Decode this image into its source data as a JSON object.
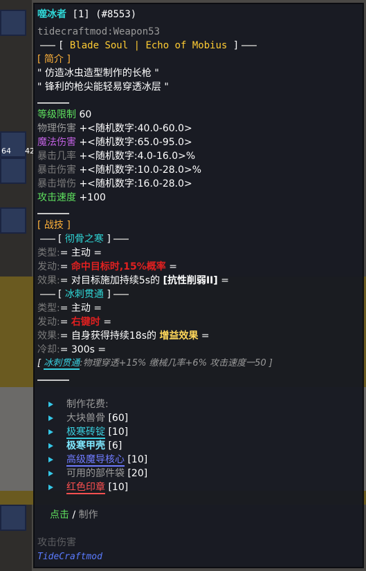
{
  "header": {
    "name": "噬冰者",
    "count": "[1]",
    "id": "(#8553)",
    "internal_name": "tidecraftmod:Weapon53",
    "series": "Blade Soul | Echo of Mobius"
  },
  "intro": {
    "tag": "[ 简介 ]",
    "lines": [
      "\" 仿造冰虫造型制作的长枪 \"",
      "\" 锋利的枪尖能轻易穿透冰层 \""
    ]
  },
  "stats": [
    {
      "label": "等级限制",
      "value": "60",
      "color": "#5ee05e"
    },
    {
      "label": "物理伤害",
      "value": "+<随机数字:40.0-60.0>",
      "color": "#9a9a9a"
    },
    {
      "label": "魔法伤害",
      "value": "+<随机数字:65.0-95.0>",
      "color": "#c060e0"
    },
    {
      "label": "暴击几率",
      "value": "+<随机数字:4.0-16.0>%",
      "color": "#7a7a7a"
    },
    {
      "label": "暴击伤害",
      "value": "+<随机数字:10.0-28.0>%",
      "color": "#7a7a7a"
    },
    {
      "label": "暴击增伤",
      "value": "+<随机数字:16.0-28.0>",
      "color": "#7a7a7a"
    },
    {
      "label": "攻击速度",
      "value": "+100",
      "color": "#5ee05e"
    }
  ],
  "skills": {
    "tag": "[ 战技 ]",
    "skill1": {
      "name": "彻骨之寒",
      "type_label": "类型:",
      "type_value": "= 主动 =",
      "trigger_label": "发动:",
      "trigger_value": "命中目标时,15%概率",
      "trigger_end": "=",
      "effect_label": "效果:",
      "effect_value": "= 对目标施加持续5s的",
      "effect_bold": "[抗性削弱II]",
      "effect_end": "="
    },
    "skill2": {
      "name": "冰刺贯通",
      "type_label": "类型:",
      "type_value": "= 主动 =",
      "trigger_label": "发动:",
      "trigger_value": "右键时",
      "trigger_end": "=",
      "effect_label": "效果:",
      "effect_value": "= 自身获得持续18s的",
      "effect_highlight": "增益效果",
      "effect_end": "=",
      "cooldown_label": "冷却:",
      "cooldown_value": "= 300s ="
    },
    "buff_line": {
      "open": "[",
      "name": "冰刺贯通",
      "text": ":物理穿透+15% 缴械几率+6% 攻击速度一50 ]"
    }
  },
  "crafting": {
    "title": "制作花费:",
    "items": [
      {
        "name": "大块兽骨",
        "count": "[60]",
        "style": "plain"
      },
      {
        "name": "极寒砖锭",
        "count": "[10]",
        "style": "u-cyan"
      },
      {
        "name": "极寒甲壳",
        "count": "[6]",
        "style": "bold-cyan"
      },
      {
        "name": "高级魔导核心",
        "count": "[10]",
        "style": "u-purple"
      },
      {
        "name": "可用的部件袋",
        "count": "[20]",
        "style": "plain"
      },
      {
        "name": "红色印章",
        "count": "[10]",
        "style": "u-red"
      }
    ],
    "action_click": "点击",
    "action_sep": "/",
    "action_craft": "制作"
  },
  "footer": {
    "overlap_text": "攻击伤害",
    "mod_name": "TideCraftmod"
  },
  "inventory": {
    "slot_counts": [
      "64",
      "42"
    ]
  }
}
